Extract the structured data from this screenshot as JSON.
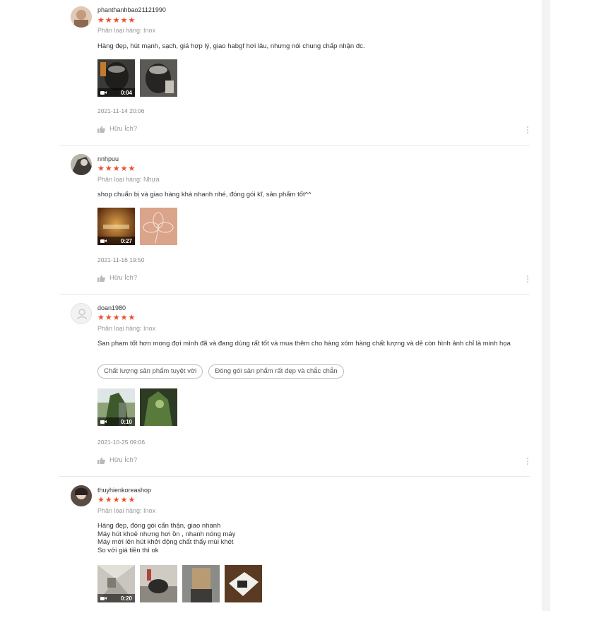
{
  "helpful_label": "Hữu Ích?",
  "reviews": [
    {
      "username": "phanthanhbao21121990",
      "stars": "★★★★★",
      "variant": "Phân loại hàng: Inox",
      "comment": "Hàng đẹp,  hút mạnh,  sạch,  giá hợp lý,  giao habgf hơi lâu,  nhưng nói chung chấp nhận đc.",
      "media": [
        {
          "duration": "0:04"
        },
        {
          "duration": ""
        }
      ],
      "date": "2021-11-14 20:06"
    },
    {
      "username": "nnhpuu",
      "stars": "★★★★★",
      "variant": "Phân loại hàng: Nhựa",
      "comment": "shop chuẩn bị và giao hàng khá nhanh nhé, đóng gói kĩ, sản phẩm tốt^^",
      "media": [
        {
          "duration": "0:27"
        },
        {
          "duration": ""
        }
      ],
      "date": "2021-11-16 19:50"
    },
    {
      "username": "doan1980",
      "stars": "★★★★★",
      "variant": "Phân loại hàng: Inox",
      "comment": "San pham tốt hơn mong đợi mình đã và đang dùng rất tốt và mua thêm cho hàng xóm hàng chất lượng và dẻ còn hình ảnh chỉ là minh họa",
      "tags": [
        "Chất lượng sản phẩm tuyệt vời",
        "Đóng gói sản phẩm rất đẹp và chắc chắn"
      ],
      "media": [
        {
          "duration": "0:10"
        },
        {
          "duration": ""
        }
      ],
      "date": "2021-10-25 09:06"
    },
    {
      "username": "thuyhienkoreashop",
      "stars": "★★★★★",
      "variant": "Phân loại hàng: Inox",
      "comment": "Hàng đẹp, đóng gói cẩn thận, giao nhanh\nMáy hút khoẻ nhưng hơi ồn , nhanh nóng máy\nMáy mới lên hút khởi động chất thấy mùi khét\nSo với giá tiền thì ok",
      "media": [
        {
          "duration": "0:20"
        },
        {
          "duration": ""
        },
        {
          "duration": ""
        },
        {
          "duration": ""
        }
      ]
    }
  ],
  "colors": {
    "star": "#ee4d2d",
    "muted": "#9a9a9a",
    "divider": "#e8e8e8"
  }
}
